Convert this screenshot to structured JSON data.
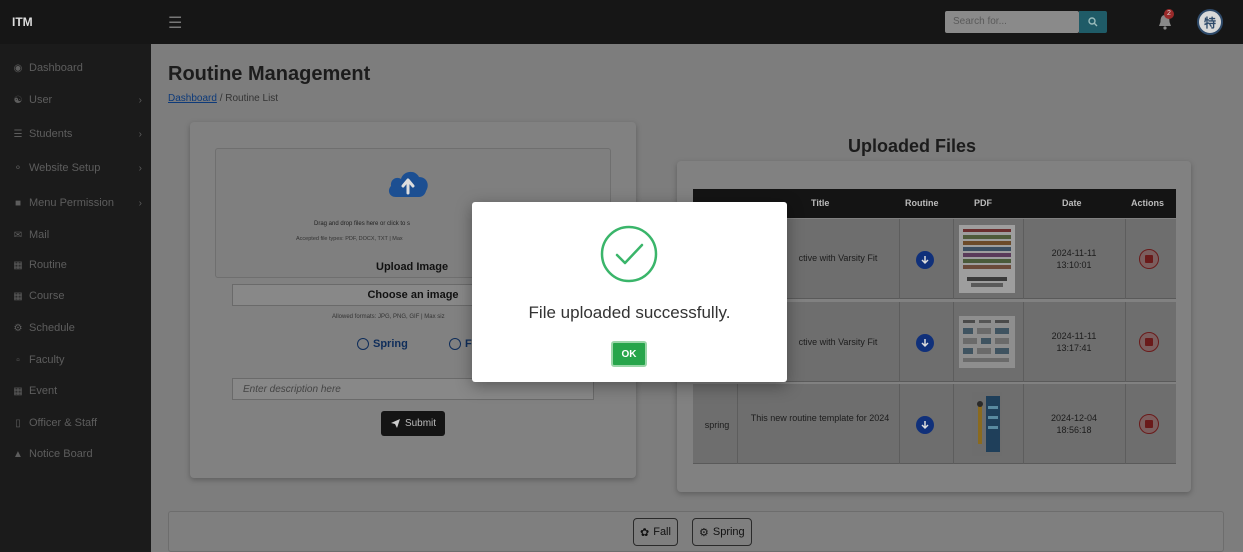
{
  "topbar": {
    "brand": "ITM",
    "search_placeholder": "Search for...",
    "notification_count": "2"
  },
  "sidebar": {
    "items": [
      {
        "label": "Dashboard",
        "icon": "dashboard-icon",
        "has_submenu": false
      },
      {
        "label": "User",
        "icon": "users-icon",
        "has_submenu": true
      },
      {
        "label": "Students",
        "icon": "student-icon",
        "has_submenu": true
      },
      {
        "label": "Website Setup",
        "icon": "website-icon",
        "has_submenu": true
      },
      {
        "label": "Menu Permission",
        "icon": "lock-icon",
        "has_submenu": true
      },
      {
        "label": "Mail",
        "icon": "mail-icon",
        "has_submenu": false
      },
      {
        "label": "Routine",
        "icon": "routine-icon",
        "has_submenu": false
      },
      {
        "label": "Course",
        "icon": "course-icon",
        "has_submenu": false
      },
      {
        "label": "Schedule",
        "icon": "gear-icon",
        "has_submenu": false
      },
      {
        "label": "Faculty",
        "icon": "chat-icon",
        "has_submenu": false
      },
      {
        "label": "Event",
        "icon": "calendar-icon",
        "has_submenu": false
      },
      {
        "label": "Officer & Staff",
        "icon": "staff-icon",
        "has_submenu": false
      },
      {
        "label": "Notice Board",
        "icon": "pin-icon",
        "has_submenu": false
      }
    ]
  },
  "main": {
    "title": "Routine Management",
    "breadcrumb": {
      "link": "Dashboard",
      "separator": " / ",
      "current": "Routine List"
    },
    "upload": {
      "drag_text": "Drag and drop files here or click to s",
      "accepted_text": "Accepted file types: PDF, DOCX, TXT | Max",
      "upload_image_label": "Upload Image",
      "choose_label": "Choose an image",
      "formats_text": "Allowed formats: JPG, PNG, GIF | Max siz",
      "radio_spring": "Spring",
      "radio_fall": "F",
      "description_placeholder": "Enter description here",
      "submit_label": "Submit"
    },
    "files": {
      "title": "Uploaded Files",
      "headers": {
        "title": "Title",
        "routine": "Routine",
        "pdf": "PDF",
        "date": "Date",
        "actions": "Actions"
      },
      "rows": [
        {
          "semester": "",
          "title": "ctive with Varsity Fit",
          "date": "2024-11-11",
          "time": "13:10:01"
        },
        {
          "semester": "",
          "title": "ctive with Varsity Fit",
          "date": "2024-11-11",
          "time": "13:17:41"
        },
        {
          "semester": "spring",
          "title": "This new routine template for 2024",
          "date": "2024-12-04",
          "time": "18:56:18"
        }
      ]
    },
    "filters": {
      "fall": "Fall",
      "spring": "Spring"
    }
  },
  "modal": {
    "message": "File uploaded successfully.",
    "ok_label": "OK",
    "accent": "#27a54b"
  }
}
